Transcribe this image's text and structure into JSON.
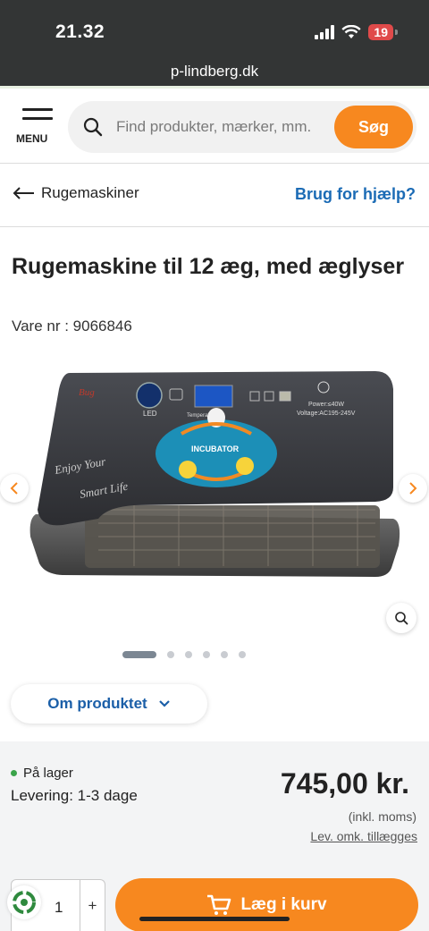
{
  "status_bar": {
    "time": "21.32",
    "battery": "19"
  },
  "browser": {
    "url": "p-lindberg.dk"
  },
  "header": {
    "menu_label": "MENU",
    "search_placeholder": "Find produkter, mærker, mm.",
    "search_button": "Søg"
  },
  "breadcrumb": {
    "back_label": "Rugemaskiner",
    "help_label": "Brug for hjælp?"
  },
  "product": {
    "title": "Rugemaskine til 12 æg, med æglyser",
    "sku": "Vare nr : 9066846",
    "image_text": {
      "brand": "Bug",
      "led": "LED",
      "temperature": "Temperature",
      "power": "Power:≤40W",
      "voltage": "Voltage:AC195-245V",
      "badge": "INCUBATOR",
      "slogan1": "Enjoy Your",
      "slogan2": "Smart Life"
    },
    "gallery": {
      "image_count": 6,
      "active_index": 0
    },
    "about_button": "Om produktet"
  },
  "purchase": {
    "stock_status": "På lager",
    "delivery": "Levering: 1-3 dage",
    "price": "745,00 kr.",
    "vat_note": "(inkl. moms)",
    "fees_link": "Lev. omk. tillægges",
    "quantity": "1",
    "plus": "+",
    "cart_button": "Læg i kurv"
  },
  "colors": {
    "accent": "#f7881f",
    "link": "#1b6bb5",
    "stock": "#3aa44a"
  }
}
